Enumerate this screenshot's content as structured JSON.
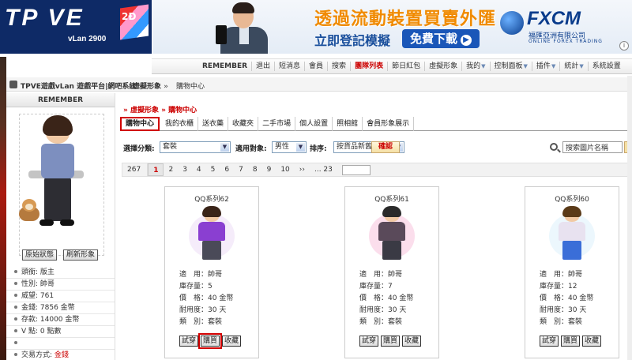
{
  "banner": {
    "logo_text": "TP VE",
    "logo_sub": "vLan 2900",
    "logo_badge": "2Ð",
    "ad_title": "透過流動裝置買賣外匯",
    "ad_cta_primary": "立即登記模擬",
    "ad_cta_secondary": "免費下載",
    "ad_brand": "FXCM",
    "ad_brand_sub": "福匯亞洲有限公司",
    "ad_brand_sub2": "ONLINE FOREX TRADING",
    "ad_info": "i"
  },
  "topnav": {
    "user": "REMEMBER",
    "links": [
      {
        "label": "退出",
        "red": false,
        "dropdown": false
      },
      {
        "label": "短消息",
        "red": false,
        "dropdown": false
      },
      {
        "label": "會員",
        "red": false,
        "dropdown": false
      },
      {
        "label": "搜索",
        "red": false,
        "dropdown": false
      },
      {
        "label": "團隊列表",
        "red": true,
        "dropdown": false
      },
      {
        "label": "節日紅包",
        "red": false,
        "dropdown": false
      },
      {
        "label": "虛擬形象",
        "red": false,
        "dropdown": false
      },
      {
        "label": "我的",
        "red": false,
        "dropdown": true
      },
      {
        "label": "控制面板",
        "red": false,
        "dropdown": true
      },
      {
        "label": "插件",
        "red": false,
        "dropdown": true
      },
      {
        "label": "統計",
        "red": false,
        "dropdown": true
      },
      {
        "label": "系統設置",
        "red": false,
        "dropdown": false
      }
    ]
  },
  "breadcrumb": {
    "part1": "TPVE遊戲vLan 遊戲平台|網吧系統",
    "sep": "»",
    "part2": "虛擬形象",
    "part3": "購物中心"
  },
  "sidebar": {
    "username": "REMEMBER",
    "btn_reset": "原始狀態",
    "btn_refresh": "刷新形象",
    "stats": [
      {
        "text": "頭銜: 版主",
        "red": ""
      },
      {
        "text": "性別: 帥哥",
        "red": ""
      },
      {
        "text": "威望: 761",
        "red": ""
      },
      {
        "text": "金錢: 7856 金幣",
        "red": ""
      },
      {
        "text": "存款: 14000 金幣",
        "red": ""
      },
      {
        "text": "V 點: 0 點數",
        "red": ""
      },
      {
        "text": "",
        "red": ""
      },
      {
        "text": "交易方式: ",
        "red": "金錢"
      }
    ]
  },
  "main": {
    "title_prefix": "»",
    "title_part1": "虛擬形象",
    "title_sep": "»",
    "title_part2": "購物中心",
    "tabs": [
      {
        "label": "購物中心",
        "active": true
      },
      {
        "label": "我的衣櫃",
        "active": false
      },
      {
        "label": "送衣藥",
        "active": false
      },
      {
        "label": "收藏夾",
        "active": false
      },
      {
        "label": "二手市場",
        "active": false
      },
      {
        "label": "個人設置",
        "active": false
      },
      {
        "label": "照相館",
        "active": false
      },
      {
        "label": "會員形象展示",
        "active": false
      }
    ],
    "filters": {
      "category_label": "選擇分類:",
      "category_value": "套裝",
      "target_label": "適用對象:",
      "target_value": "男性",
      "sort_label": "排序:",
      "sort_value": "按貨品新舊排序",
      "confirm": "確認",
      "search_placeholder": "搜索圖片名稱"
    },
    "pager": {
      "total": "267",
      "pages": [
        "1",
        "2",
        "3",
        "4",
        "5",
        "6",
        "7",
        "8",
        "9",
        "10"
      ],
      "current": "1",
      "next": "››",
      "last": "... 23"
    },
    "items": [
      {
        "name": "QQ系列62",
        "fit": "適　用：帥哥",
        "stock": "庫存量：5",
        "price": "價　格：40 金幣",
        "durability": "耐用度：30 天",
        "type": "類　別：套裝",
        "colors": {
          "hair": "#3a2418",
          "top": "#8a3fd1",
          "bottom": "#4a4a58",
          "deco": "#e2c8f0"
        }
      },
      {
        "name": "QQ系列61",
        "fit": "適　用：帥哥",
        "stock": "庫存量：7",
        "price": "價　格：40 金幣",
        "durability": "耐用度：30 天",
        "type": "類　別：套裝",
        "colors": {
          "hair": "#2a2a2a",
          "top": "#5a4a5a",
          "bottom": "#3a3a44",
          "deco": "#f4a0c8"
        }
      },
      {
        "name": "QQ系列60",
        "fit": "適　用：帥哥",
        "stock": "庫存量：12",
        "price": "價　格：40 金幣",
        "durability": "耐用度：30 天",
        "type": "類　別：套裝",
        "colors": {
          "hair": "#5a3a18",
          "top": "#e8e2f0",
          "bottom": "#3a6ed8",
          "deco": "#c8e8f8"
        }
      }
    ],
    "buttons": {
      "try": "試穿",
      "buy": "購買",
      "fav": "收藏"
    }
  }
}
